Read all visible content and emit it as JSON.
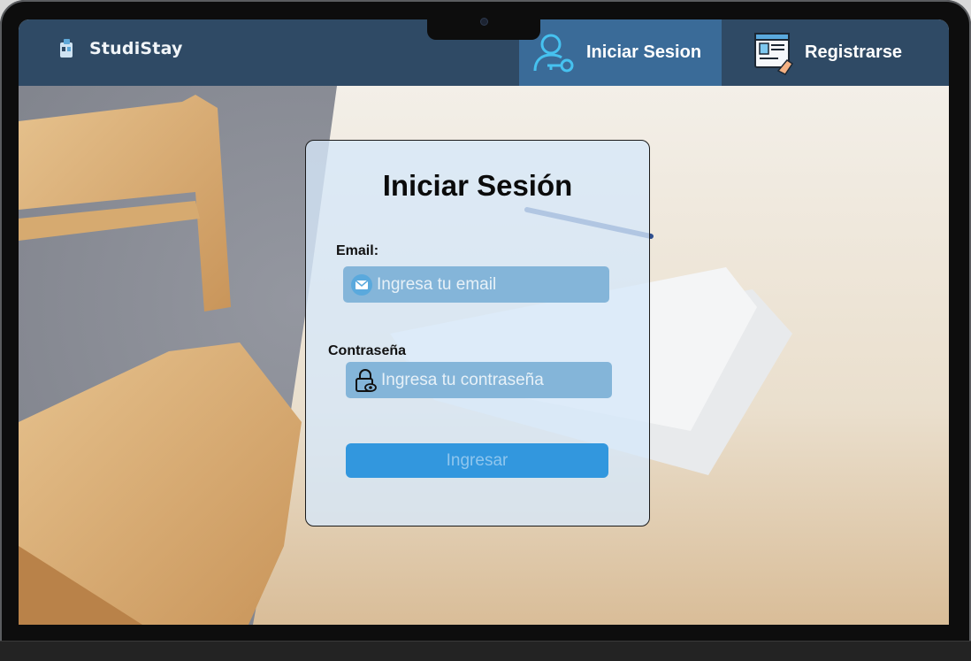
{
  "header": {
    "logo_text": "StudiStay",
    "nav": {
      "login_label": "Iniciar Sesion",
      "register_label": "Registrarse"
    }
  },
  "login_card": {
    "title": "Iniciar Sesión",
    "email": {
      "label": "Email:",
      "placeholder": "Ingresa tu email"
    },
    "password": {
      "label": "Contraseña",
      "placeholder": "Ingresa tu contraseña"
    },
    "submit_label": "Ingresar"
  },
  "icons": {
    "logo": "studistay-logo-icon",
    "login": "user-key-icon",
    "register": "document-sign-icon",
    "email": "envelope-icon",
    "password": "lock-eye-icon"
  },
  "colors": {
    "navbar": "#2f4a65",
    "active_nav": "#3a6b98",
    "input_bg": "#84b5d9",
    "button_bg": "#3297de"
  }
}
